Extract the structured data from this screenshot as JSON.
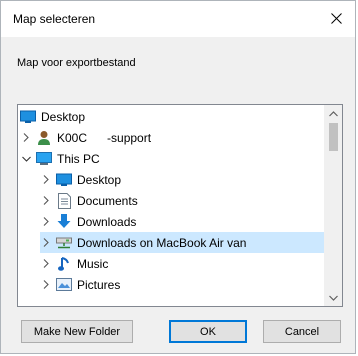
{
  "window": {
    "title": "Map selecteren",
    "close_glyph": "✕"
  },
  "prompt": "Map voor exportbestand",
  "tree": {
    "items": [
      {
        "label": "Desktop",
        "icon": "desktop-icon",
        "expander": "none",
        "indent": 0,
        "selected": false
      },
      {
        "label": "K00C      -support",
        "icon": "user-icon",
        "expander": "collapsed",
        "indent": 1,
        "selected": false
      },
      {
        "label": "This PC",
        "icon": "computer-icon",
        "expander": "expanded",
        "indent": 1,
        "selected": false
      },
      {
        "label": "Desktop",
        "icon": "desktop-icon",
        "expander": "collapsed",
        "indent": 2,
        "selected": false
      },
      {
        "label": "Documents",
        "icon": "documents-icon",
        "expander": "collapsed",
        "indent": 2,
        "selected": false
      },
      {
        "label": "Downloads",
        "icon": "downloads-icon",
        "expander": "collapsed",
        "indent": 2,
        "selected": false
      },
      {
        "label": "Downloads on MacBook Air van",
        "icon": "network-drive-icon",
        "expander": "collapsed",
        "indent": 2,
        "selected": true
      },
      {
        "label": "Music",
        "icon": "music-icon",
        "expander": "collapsed",
        "indent": 2,
        "selected": false
      },
      {
        "label": "Pictures",
        "icon": "pictures-icon",
        "expander": "collapsed",
        "indent": 2,
        "selected": false
      }
    ]
  },
  "buttons": {
    "new_folder": "Make New Folder",
    "ok": "OK",
    "cancel": "Cancel"
  },
  "colors": {
    "selection": "#cce8ff",
    "default_button_border": "#0078d7",
    "folder_blue": "#1e90e0"
  }
}
